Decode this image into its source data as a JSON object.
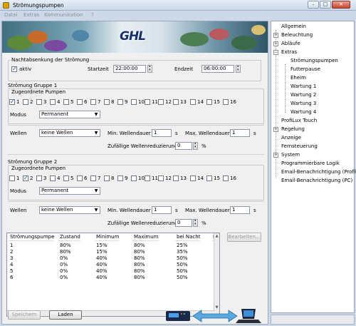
{
  "window": {
    "title": "Strömungspumpen"
  },
  "menu": [
    "Datei",
    "Extras",
    "Kommunikation",
    "?"
  ],
  "banner": {
    "logo": "GHL"
  },
  "night": {
    "group_label": "Nachtabsenkung der Strömung",
    "active_label": "aktiv",
    "active": true,
    "start_label": "Startzeit",
    "start_value": "22:00:00",
    "end_label": "Endzeit",
    "end_value": "06:00:00"
  },
  "group1": {
    "group_label": "Strömung Gruppe 1",
    "pumps_label": "Zugeordnete Pumpen",
    "pumps": [
      "1",
      "2",
      "3",
      "4",
      "5",
      "6",
      "7",
      "8",
      "9",
      "10",
      "11",
      "12",
      "13",
      "14",
      "15",
      "16"
    ],
    "checked": [
      1
    ],
    "modus_label": "Modus",
    "modus_value": "Permanent",
    "wellen_label": "Wellen",
    "wellen_value": "keine Wellen",
    "min_label": "Min. Wellendauer",
    "min_value": "1",
    "min_unit": "s",
    "max_label": "Max. Wellendauer",
    "max_value": "1",
    "max_unit": "s",
    "reduction_label": "Zufällige Wellenreduzierung",
    "reduction_value": "0",
    "reduction_unit": "%"
  },
  "group2": {
    "group_label": "Strömung Gruppe 2",
    "pumps_label": "Zugeordnete Pumpen",
    "pumps": [
      "1",
      "2",
      "3",
      "4",
      "5",
      "6",
      "7",
      "8",
      "9",
      "10",
      "11",
      "12",
      "13",
      "14",
      "15",
      "16"
    ],
    "checked": [
      2
    ],
    "modus_label": "Modus",
    "modus_value": "Permanent",
    "wellen_label": "Wellen",
    "wellen_value": "keine Wellen",
    "min_label": "Min. Wellendauer",
    "min_value": "1",
    "min_unit": "s",
    "max_label": "Max. Wellendauer",
    "max_value": "1",
    "max_unit": "s",
    "reduction_label": "Zufällige Wellenreduzierung",
    "reduction_value": "0",
    "reduction_unit": "%"
  },
  "table": {
    "columns": [
      "Strömungspumpe",
      "Zustand",
      "Minimum",
      "Maximum",
      "bei Nacht",
      "I"
    ],
    "rows": [
      [
        "1",
        "80%",
        "15%",
        "80%",
        "25%"
      ],
      [
        "2",
        "80%",
        "15%",
        "80%",
        "35%"
      ],
      [
        "3",
        "0%",
        "40%",
        "80%",
        "50%"
      ],
      [
        "4",
        "0%",
        "40%",
        "80%",
        "50%"
      ],
      [
        "5",
        "0%",
        "40%",
        "80%",
        "50%"
      ],
      [
        "6",
        "0%",
        "40%",
        "80%",
        "50%"
      ]
    ]
  },
  "buttons": {
    "edit": "Bearbeiten...",
    "save": "Speichern",
    "load": "Laden"
  },
  "tree": {
    "items": [
      {
        "label": "Allgemein",
        "level": 0,
        "expander": ""
      },
      {
        "label": "Beleuchtung",
        "level": 0,
        "expander": "+"
      },
      {
        "label": "Abläufe",
        "level": 0,
        "expander": "+"
      },
      {
        "label": "Extras",
        "level": 0,
        "expander": "−"
      },
      {
        "label": "Strömungspumpen",
        "level": 1,
        "expander": ""
      },
      {
        "label": "Futterpause",
        "level": 1,
        "expander": ""
      },
      {
        "label": "Eheim",
        "level": 1,
        "expander": ""
      },
      {
        "label": "Wartung 1",
        "level": 1,
        "expander": ""
      },
      {
        "label": "Wartung 2",
        "level": 1,
        "expander": ""
      },
      {
        "label": "Wartung 3",
        "level": 1,
        "expander": ""
      },
      {
        "label": "Wartung 4",
        "level": 1,
        "expander": ""
      },
      {
        "label": "ProfiLux Touch",
        "level": 0,
        "expander": ""
      },
      {
        "label": "Regelung",
        "level": 0,
        "expander": "+"
      },
      {
        "label": "Anzeige",
        "level": 0,
        "expander": ""
      },
      {
        "label": "Fernsteuerung",
        "level": 0,
        "expander": ""
      },
      {
        "label": "System",
        "level": 0,
        "expander": "+"
      },
      {
        "label": "Programmierbare Logik",
        "level": 0,
        "expander": ""
      },
      {
        "label": "Email-Benachrichtigung (Profilux)",
        "level": 0,
        "expander": ""
      },
      {
        "label": "Email-Benachrichtigung (PC)",
        "level": 0,
        "expander": ""
      }
    ]
  }
}
